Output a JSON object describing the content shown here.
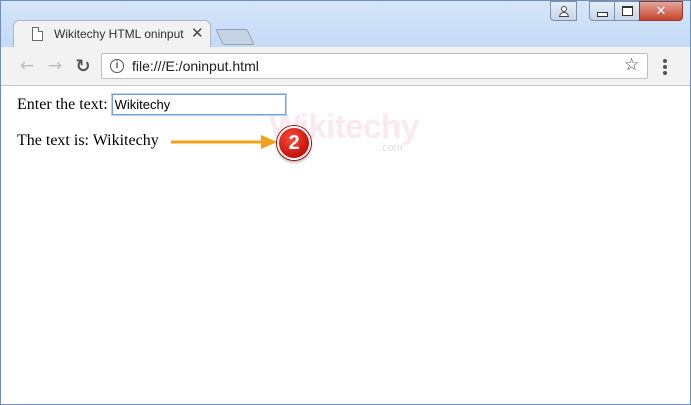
{
  "browser": {
    "tab_title": "Wikitechy HTML oninput",
    "tab_close": "✕",
    "url": "file:///E:/oninput.html",
    "nav": {
      "back": "←",
      "forward": "→",
      "reload": "↻"
    },
    "star": "☆",
    "close_glyph": "✕",
    "info_glyph": "i"
  },
  "page": {
    "input_label": "Enter the text:",
    "input_value": "Wikitechy",
    "output_label": "The text is:",
    "output_value": "Wikitechy",
    "watermark": "Wikitechy",
    "watermark_sub": ".com"
  },
  "annotation": {
    "step_number": "2",
    "badge_color": "#e2150d",
    "arrow_color": "#f2a21a"
  }
}
